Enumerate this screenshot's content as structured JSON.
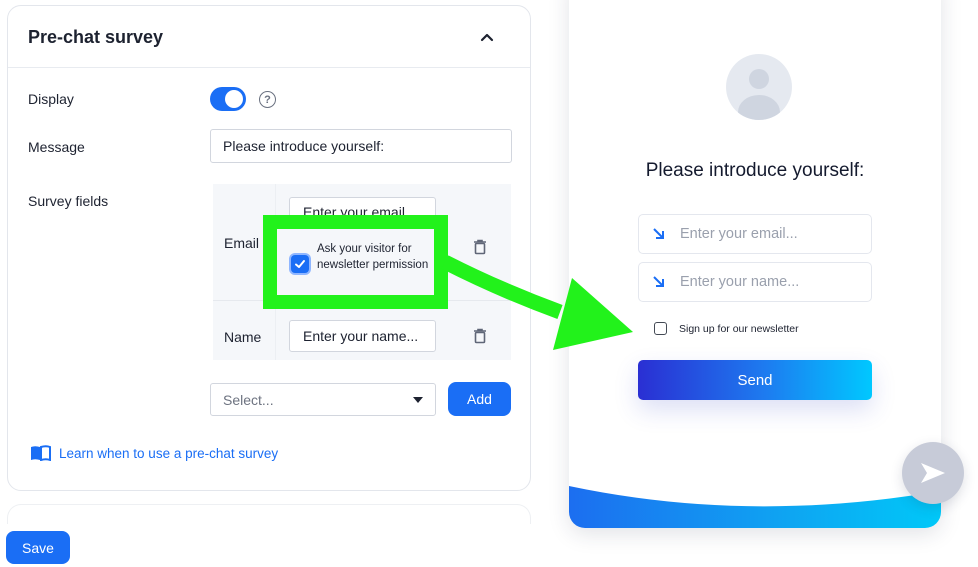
{
  "settings": {
    "section_title": "Pre-chat survey",
    "display_label": "Display",
    "display_toggle_on": true,
    "help_symbol": "?",
    "message_label": "Message",
    "message_value": "Please introduce yourself:",
    "survey_fields_label": "Survey fields",
    "fields": [
      {
        "name": "Email",
        "placeholder": "Enter your email...",
        "newsletter_option_label": "Ask your visitor for newsletter permission",
        "newsletter_option_checked": true
      },
      {
        "name": "Name",
        "placeholder": "Enter your name..."
      }
    ],
    "select_placeholder": "Select...",
    "add_label": "Add",
    "learn_link": "Learn when to use a pre-chat survey",
    "save_label": "Save"
  },
  "preview": {
    "title": "Please introduce yourself:",
    "email_placeholder": "Enter your email...",
    "name_placeholder": "Enter your name...",
    "newsletter_label": "Sign up for our newsletter",
    "newsletter_checked": false,
    "send_label": "Send"
  },
  "colors": {
    "accent": "#1a6ef5",
    "annotation": "#22f21b",
    "send_gradient_start": "#2a2fd3",
    "send_gradient_end": "#00c8ff",
    "launcher": "#c7cbd8"
  },
  "icons": {
    "collapse": "chevron-up-icon",
    "help": "question-circle-icon",
    "delete": "trash-icon",
    "dropdown": "caret-down-icon",
    "learn": "book-icon",
    "avatar": "user-avatar-icon",
    "input_prefix": "arrow-down-right-icon",
    "launcher": "send-icon"
  }
}
